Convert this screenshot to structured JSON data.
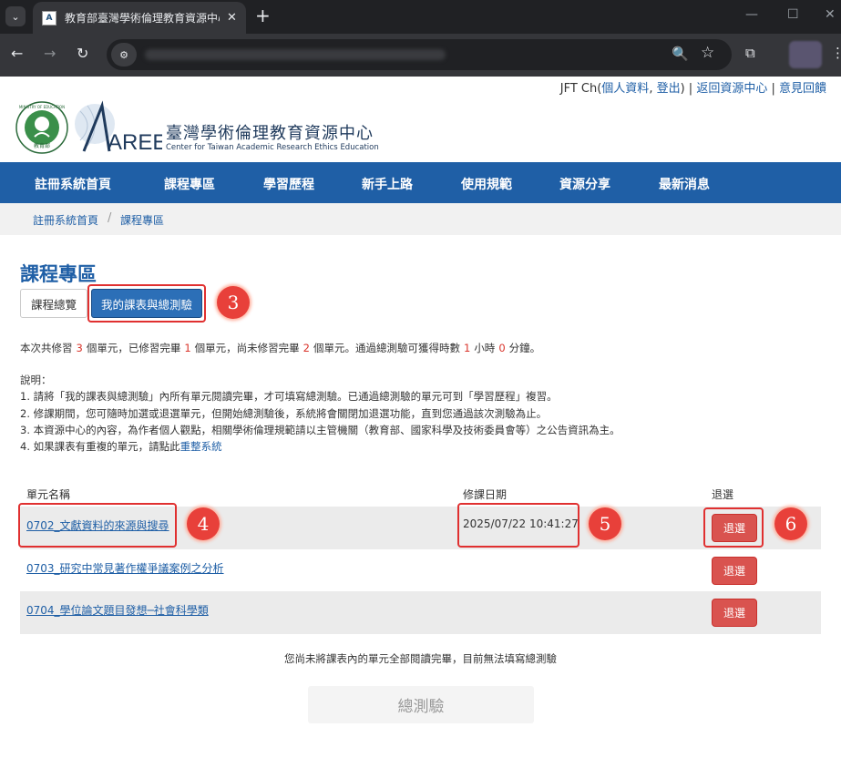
{
  "browser": {
    "tab_title": "教育部臺灣學術倫理教育資源中心",
    "favicon_text": "A",
    "new_tab": "+",
    "tab_close": "✕",
    "icons": {
      "back": "←",
      "forward": "→",
      "reload": "↻",
      "site_info": "⚙",
      "zoom": "🔍",
      "star": "☆",
      "extensions": "⧉",
      "menu": "⋮",
      "tab_menu": "⌄",
      "minimize": "—",
      "maximize": "☐",
      "close": "✕"
    }
  },
  "userbar": {
    "user": "JFT Ch",
    "profile_link": "個人資料",
    "logout_link": "登出",
    "back_link": "返回資源中心",
    "feedback_link": "意見回饋"
  },
  "header": {
    "logo_moe_top": "MINISTRY OF EDUCATION",
    "logo_moe_bottom": "教育部",
    "logo_aree": "AREE",
    "title_zh": "臺灣學術倫理教育資源中心",
    "title_en": "Center for Taiwan Academic Research Ethics Education"
  },
  "nav": {
    "items": [
      "註冊系統首頁",
      "課程專區",
      "學習歷程",
      "新手上路",
      "使用規範",
      "資源分享",
      "最新消息"
    ]
  },
  "breadcrumb": {
    "home": "註冊系統首頁",
    "sep": "/",
    "current": "課程專區"
  },
  "page": {
    "heading": "課程專區",
    "tab_overview": "課程總覽",
    "tab_mine": "我的課表與總測驗"
  },
  "summary": {
    "p1": "本次共修習",
    "total": "3",
    "p2": "個單元，已修習完畢",
    "done": "1",
    "p3": "個單元，尚未修習完畢",
    "pending": "2",
    "p4": "個單元。通過總測驗可獲得時數",
    "hours": "1",
    "p5": "小時",
    "minutes": "0",
    "p6": "分鐘。"
  },
  "notes": {
    "title": "說明：",
    "n1": "1. 請將「我的課表與總測驗」內所有單元閱讀完畢，才可填寫總測驗。已通過總測驗的單元可到「學習歷程」複習。",
    "n2": "2. 修課期間，您可隨時加選或退選單元，但開始總測驗後，系統將會關閉加退選功能，直到您通過該次測驗為止。",
    "n3": "3. 本資源中心的內容，為作者個人觀點，相關學術倫理規範請以主管機關（教育部、國家科學及技術委員會等）之公告資訊為主。",
    "n4_prefix": "4. 如果課表有重複的單元，請點此",
    "n4_link": "重整系統"
  },
  "table": {
    "headers": {
      "unit": "單元名稱",
      "date": "修課日期",
      "drop": "退選"
    },
    "rows": [
      {
        "unit": "0702_文獻資料的來源與搜尋",
        "date": "2025/07/22 10:41:27",
        "drop": "退選"
      },
      {
        "unit": "0703_研究中常見著作權爭議案例之分析",
        "date": "",
        "drop": "退選"
      },
      {
        "unit": "0704_學位論文題目發想─社會科學類",
        "date": "",
        "drop": "退選"
      }
    ]
  },
  "notice": "您尚未將課表內的單元全部閱讀完畢，目前無法填寫總測驗",
  "exam_button": "總測驗",
  "markers": [
    "3",
    "4",
    "5",
    "6"
  ],
  "colors": {
    "brand_blue": "#1f5fa6",
    "drop_red": "#d9534f",
    "highlight_red": "#e03030"
  }
}
